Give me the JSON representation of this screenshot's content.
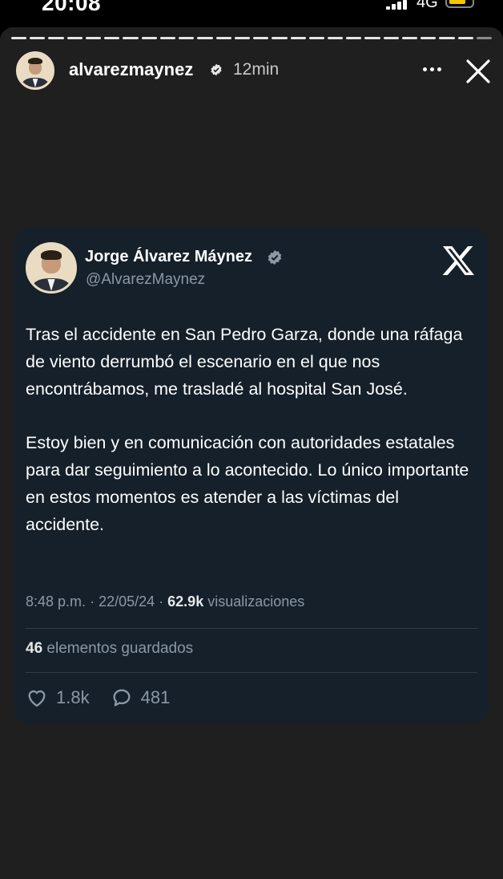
{
  "status_bar": {
    "time": "20:08",
    "network": "4G",
    "icons": [
      "cellular-signal-icon",
      "battery-icon"
    ]
  },
  "story": {
    "username": "alvarezmaynez",
    "time_ago": "12min",
    "icons": [
      "verified-badge-icon",
      "more-options-icon",
      "close-icon"
    ]
  },
  "tweet": {
    "author_name": "Jorge Álvarez Máynez",
    "handle": "@AlvarezMaynez",
    "paragraphs": [
      "Tras el accidente en San Pedro Garza, donde una ráfaga de viento derrumbó el escenario en el que nos encontrábamos, me trasladé al hospital San José.",
      "Estoy bien y en comunicación con autoridades estatales para dar seguimiento a lo acontecido. Lo único importante en estos momentos es atender a las víctimas del accidente."
    ],
    "time": "8:48 p.m.",
    "date": "22/05/24",
    "views_count": "62.9k",
    "views_label": "visualizaciones",
    "saved_count": "46",
    "saved_label": "elementos guardados",
    "likes": "1.8k",
    "replies": "481",
    "icons": [
      "x-logo-icon",
      "heart-icon",
      "reply-bubble-icon"
    ]
  },
  "colors": {
    "story_background": "#1f1f1f",
    "card_background": "#15202b",
    "secondary_text": "#8b98a5",
    "battery": "#f5c500"
  }
}
